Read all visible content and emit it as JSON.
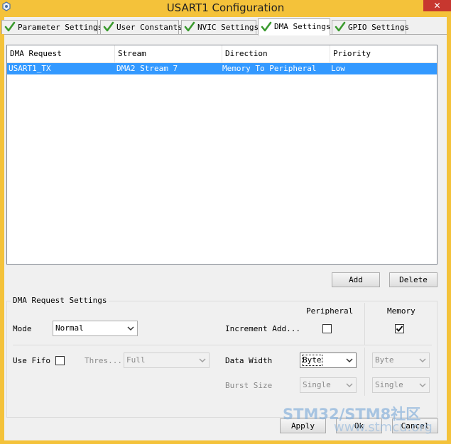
{
  "window": {
    "title": "USART1 Configuration",
    "close_glyph": "✕"
  },
  "tabs": [
    {
      "label": "Parameter Settings",
      "icon": "check-icon",
      "active": false
    },
    {
      "label": "User Constants",
      "icon": "check-icon",
      "active": false
    },
    {
      "label": "NVIC Settings",
      "icon": "check-icon",
      "active": false
    },
    {
      "label": "DMA Settings",
      "icon": "check-icon",
      "active": true
    },
    {
      "label": "GPIO Settings",
      "icon": "check-icon",
      "active": false
    }
  ],
  "dma_table": {
    "columns": [
      "DMA Request",
      "Stream",
      "Direction",
      "Priority"
    ],
    "rows": [
      {
        "request": "USART1_TX",
        "stream": "DMA2 Stream 7",
        "direction": "Memory To Peripheral",
        "priority": "Low",
        "selected": true
      }
    ]
  },
  "table_buttons": {
    "add": "Add",
    "delete": "Delete"
  },
  "request_settings": {
    "title": "DMA Request Settings",
    "peripheral_header": "Peripheral",
    "memory_header": "Memory",
    "mode_label": "Mode",
    "mode_value": "Normal",
    "increment_label": "Increment Add...",
    "increment_peripheral": false,
    "increment_memory": true,
    "use_fifo_label": "Use Fifo",
    "use_fifo": false,
    "threshold_label": "Thres...",
    "threshold_value": "Full",
    "data_width_label": "Data Width",
    "data_width_peripheral": "Byte",
    "data_width_memory": "Byte",
    "burst_size_label": "Burst Size",
    "burst_size_peripheral": "Single",
    "burst_size_memory": "Single"
  },
  "footer_buttons": {
    "apply": "Apply",
    "ok": "Ok",
    "cancel": "Cancel"
  },
  "watermark": {
    "line1": "STM32/STM8社区",
    "line2": "www.stmcu.org"
  },
  "colors": {
    "frame": "#f4c23a",
    "selection": "#3399ff",
    "check": "#3a9a2e",
    "close": "#c7372f"
  }
}
